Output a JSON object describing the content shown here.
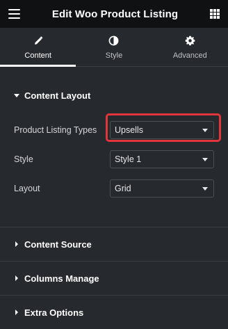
{
  "header": {
    "title": "Edit Woo Product Listing",
    "menu_icon": "hamburger-icon",
    "apps_icon": "grid-icon"
  },
  "tabs": [
    {
      "label": "Content",
      "icon": "pencil-icon",
      "active": true
    },
    {
      "label": "Style",
      "icon": "half-circle-icon",
      "active": false
    },
    {
      "label": "Advanced",
      "icon": "gear-icon",
      "active": false
    }
  ],
  "content_layout": {
    "title": "Content Layout",
    "controls": [
      {
        "label": "Product Listing Types",
        "value": "Upsells",
        "highlighted": true
      },
      {
        "label": "Style",
        "value": "Style 1"
      },
      {
        "label": "Layout",
        "value": "Grid"
      }
    ]
  },
  "sections": [
    {
      "title": "Content Source"
    },
    {
      "title": "Columns Manage"
    },
    {
      "title": "Extra Options"
    }
  ],
  "colors": {
    "highlight": "#e2353c",
    "panel_bg": "#26292d",
    "header_bg": "#101113"
  }
}
